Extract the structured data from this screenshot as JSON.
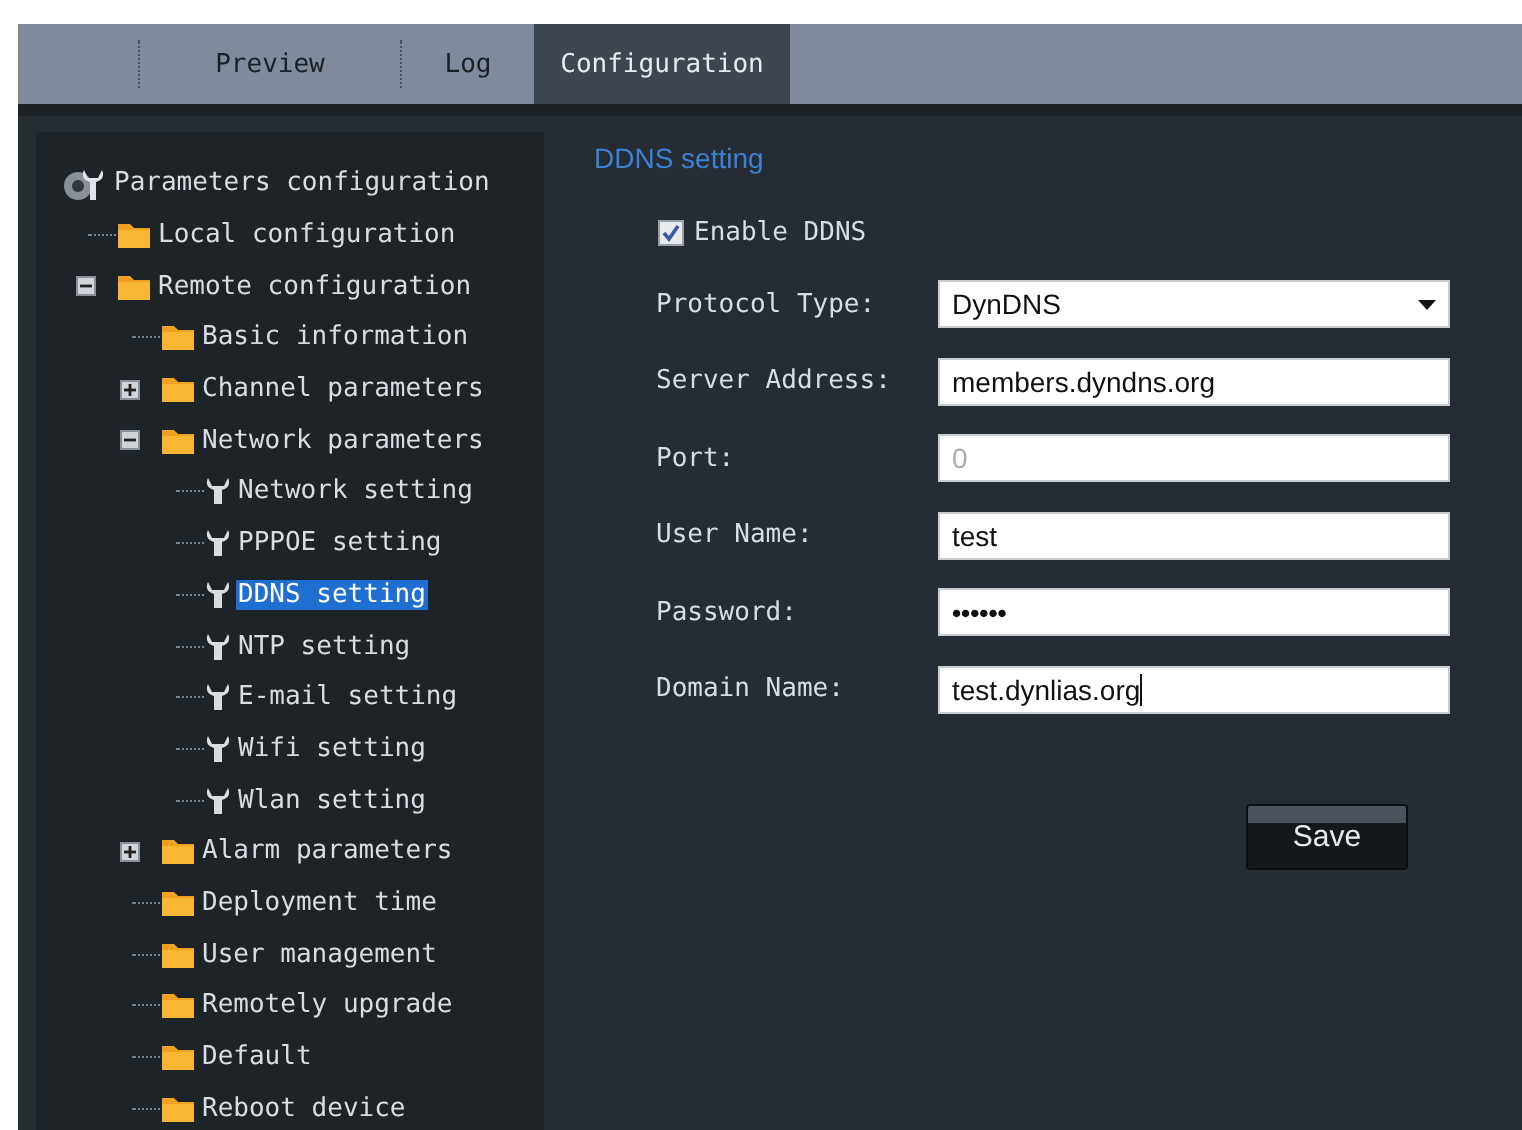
{
  "tabs": [
    {
      "label": "Preview",
      "selected": false
    },
    {
      "label": "Log",
      "selected": false
    },
    {
      "label": "Configuration",
      "selected": true
    }
  ],
  "tree": [
    {
      "label": "Parameters configuration",
      "kind": "root",
      "selected": false,
      "children": [
        {
          "label": "Local configuration",
          "kind": "folder",
          "selected": false
        },
        {
          "label": "Remote configuration",
          "kind": "folder",
          "selected": false,
          "expanded": true,
          "children": [
            {
              "label": "Basic information",
              "kind": "folder",
              "selected": false
            },
            {
              "label": "Channel parameters",
              "kind": "folder",
              "selected": false,
              "expanded": false
            },
            {
              "label": "Network parameters",
              "kind": "folder",
              "selected": false,
              "expanded": true,
              "children": [
                {
                  "label": "Network setting",
                  "kind": "setting",
                  "selected": false
                },
                {
                  "label": "PPPOE setting",
                  "kind": "setting",
                  "selected": false
                },
                {
                  "label": "DDNS setting",
                  "kind": "setting",
                  "selected": true
                },
                {
                  "label": "NTP setting",
                  "kind": "setting",
                  "selected": false
                },
                {
                  "label": "E-mail setting",
                  "kind": "setting",
                  "selected": false
                },
                {
                  "label": "Wifi setting",
                  "kind": "setting",
                  "selected": false
                },
                {
                  "label": "Wlan setting",
                  "kind": "setting",
                  "selected": false
                }
              ]
            },
            {
              "label": "Alarm parameters",
              "kind": "folder",
              "selected": false,
              "expanded": false
            },
            {
              "label": "Deployment time",
              "kind": "folder",
              "selected": false
            },
            {
              "label": "User management",
              "kind": "folder",
              "selected": false
            },
            {
              "label": "Remotely upgrade",
              "kind": "folder",
              "selected": false
            },
            {
              "label": "Default",
              "kind": "folder",
              "selected": false
            },
            {
              "label": "Reboot device",
              "kind": "folder",
              "selected": false
            }
          ]
        }
      ]
    }
  ],
  "form": {
    "title": "DDNS setting",
    "enable": {
      "label": "Enable DDNS",
      "checked": true
    },
    "fields": [
      {
        "label": "Protocol Type:",
        "kind": "select",
        "value": "DynDNS"
      },
      {
        "label": "Server Address:",
        "kind": "text",
        "value": "members.dyndns.org"
      },
      {
        "label": "Port:",
        "kind": "text",
        "placeholder": "0"
      },
      {
        "label": "User Name:",
        "kind": "text",
        "value": "test"
      },
      {
        "label": "Password:",
        "kind": "password",
        "value": "••••••"
      },
      {
        "label": "Domain Name:",
        "kind": "text",
        "value": "test.dynlias.org"
      }
    ],
    "save": "Save"
  }
}
